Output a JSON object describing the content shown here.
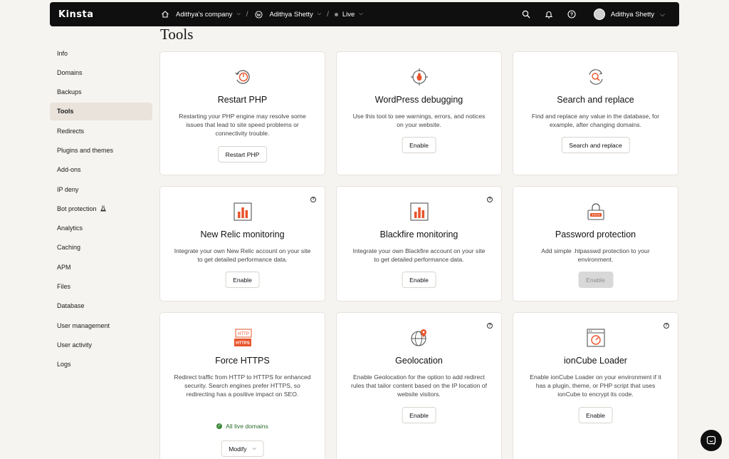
{
  "topbar": {
    "logo": "Kinsta",
    "company": "Adithya's company",
    "site": "Adithya Shetty",
    "environment": "Live",
    "user_name": "Adithya Shetty",
    "icons": [
      "home-icon",
      "wordpress-icon",
      "search-icon",
      "bell-icon",
      "help-icon"
    ]
  },
  "sidebar": {
    "items": [
      {
        "label": "Info"
      },
      {
        "label": "Domains"
      },
      {
        "label": "Backups"
      },
      {
        "label": "Tools",
        "active": true
      },
      {
        "label": "Redirects"
      },
      {
        "label": "Plugins and themes"
      },
      {
        "label": "Add-ons"
      },
      {
        "label": "IP deny"
      },
      {
        "label": "Bot protection",
        "icon": "flask-icon"
      },
      {
        "label": "Analytics"
      },
      {
        "label": "Caching"
      },
      {
        "label": "APM"
      },
      {
        "label": "Files"
      },
      {
        "label": "Database"
      },
      {
        "label": "User management"
      },
      {
        "label": "User activity"
      },
      {
        "label": "Logs"
      }
    ]
  },
  "page": {
    "title": "Tools"
  },
  "cards": {
    "restart_php": {
      "title": "Restart PHP",
      "description": "Restarting your PHP engine may resolve some issues that lead to site speed problems or connectivity trouble.",
      "button": "Restart PHP",
      "icon": "power-icon"
    },
    "wp_debug": {
      "title": "WordPress debugging",
      "description": "Use this tool to see warnings, errors, and notices on your website.",
      "button": "Enable",
      "icon": "bug-icon"
    },
    "search_replace": {
      "title": "Search and replace",
      "description": "Find and replace any value in the database, for example, after changing domains.",
      "button": "Search and replace",
      "icon": "search-replace-icon"
    },
    "new_relic": {
      "title": "New Relic monitoring",
      "description": "Integrate your own New Relic account on your site to get detailed performance data.",
      "button": "Enable",
      "icon": "bar-chart-icon"
    },
    "blackfire": {
      "title": "Blackfire monitoring",
      "description": "Integrate your own Blackfire account on your site to get detailed performance data.",
      "button": "Enable",
      "icon": "bar-chart-icon"
    },
    "password": {
      "title": "Password protection",
      "description": "Add simple .htpasswd protection to your environment.",
      "button": "Enable",
      "button_disabled": true,
      "icon": "lock-icon"
    },
    "force_https": {
      "title": "Force HTTPS",
      "description": "Redirect traffic from HTTP to HTTPS for enhanced security. Search engines prefer HTTPS, so redirecting has a positive impact on SEO.",
      "status": "All live domains",
      "button": "Modify",
      "icon": "https-icon",
      "icon_text_top": "HTTP",
      "icon_text_bottom": "HTTPS"
    },
    "geolocation": {
      "title": "Geolocation",
      "description": "Enable Geolocation for the option to add redirect rules that tailor content based on the IP location of website visitors.",
      "button": "Enable",
      "icon": "globe-pin-icon"
    },
    "ioncube": {
      "title": "ionCube Loader",
      "description": "Enable ionCube Loader on your environment if it has a plugin, theme, or PHP script that uses ionCube to encrypt its code.",
      "button": "Enable",
      "icon": "gauge-window-icon"
    }
  },
  "colors": {
    "accent": "#e8542b",
    "topbar_bg": "#0f0f10",
    "page_bg": "#f6f4f1",
    "active_nav_bg": "#e9e3dc",
    "status_green": "#3c8a3c"
  }
}
